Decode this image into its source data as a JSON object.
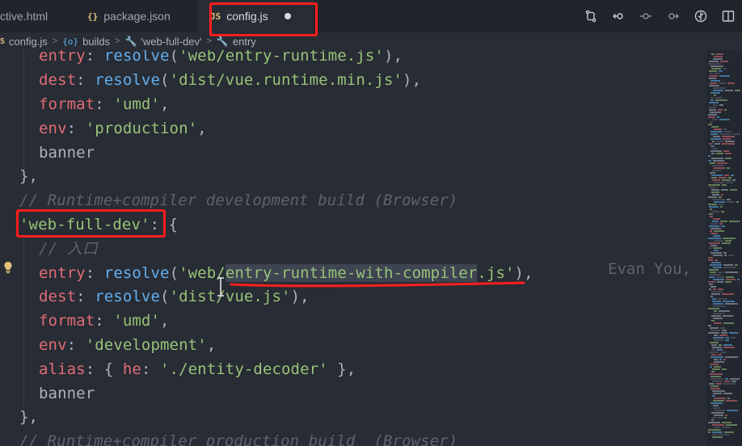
{
  "tabs": [
    {
      "name": "tab-active-html",
      "icon": "",
      "label": "ctive.html"
    },
    {
      "name": "tab-package-json",
      "icon": "{}",
      "label": "package.json"
    },
    {
      "name": "tab-config-js",
      "icon": "JS",
      "label": "config.js"
    }
  ],
  "breadcrumb": {
    "file_icon": "JS",
    "file": "config.js",
    "item1_icon": "{o}",
    "item1": "builds",
    "item2_icon": "🔧",
    "item2": "'web-full-dev'",
    "item3_icon": "🔧",
    "item3": "entry"
  },
  "code": {
    "l1": {
      "key": "entry",
      "colon": ": ",
      "fn": "resolve",
      "open": "(",
      "str": "'web/entry-runtime.js'",
      "close": "),"
    },
    "l2": {
      "key": "dest",
      "colon": ": ",
      "fn": "resolve",
      "open": "(",
      "str": "'dist/vue.runtime.min.js'",
      "close": "),"
    },
    "l3": {
      "key": "format",
      "colon": ": ",
      "str": "'umd'",
      "close": ","
    },
    "l4": {
      "key": "env",
      "colon": ": ",
      "str": "'production'",
      "close": ","
    },
    "l5": {
      "text": "banner"
    },
    "l6": {
      "text": "},"
    },
    "l7": {
      "text": "// Runtime+compiler development build (Browser)"
    },
    "l8": {
      "str": "'web-full-dev'",
      "rest": ": {"
    },
    "l9": {
      "text": "// 入口"
    },
    "l10": {
      "key": "entry",
      "colon": ": ",
      "fn": "resolve",
      "open": "(",
      "str_a": "'web/",
      "str_sel": "entry-runtime-with-compiler",
      "str_b": ".js'",
      "close": "),"
    },
    "l11": {
      "key": "dest",
      "colon": ": ",
      "fn": "resolve",
      "open": "(",
      "str": "'dist/vue.js'",
      "close": "),"
    },
    "l12": {
      "key": "format",
      "colon": ": ",
      "str": "'umd'",
      "close": ","
    },
    "l13": {
      "key": "env",
      "colon": ": ",
      "str": "'development'",
      "close": ","
    },
    "l14": {
      "key": "alias",
      "colon": ": { ",
      "key2": "he",
      "colon2": ": ",
      "str": "'./entity-decoder'",
      "close": " },"
    },
    "l15": {
      "text": "banner"
    },
    "l16": {
      "text": "},"
    },
    "l17": {
      "text": "// Runtime+compiler production build  (Browser)"
    },
    "blame": "Evan You,"
  },
  "colors": {
    "annotation": "#ff1e1e",
    "keyword": "#e06c75",
    "string": "#98c379",
    "function": "#61afef",
    "comment": "#5c6370"
  }
}
